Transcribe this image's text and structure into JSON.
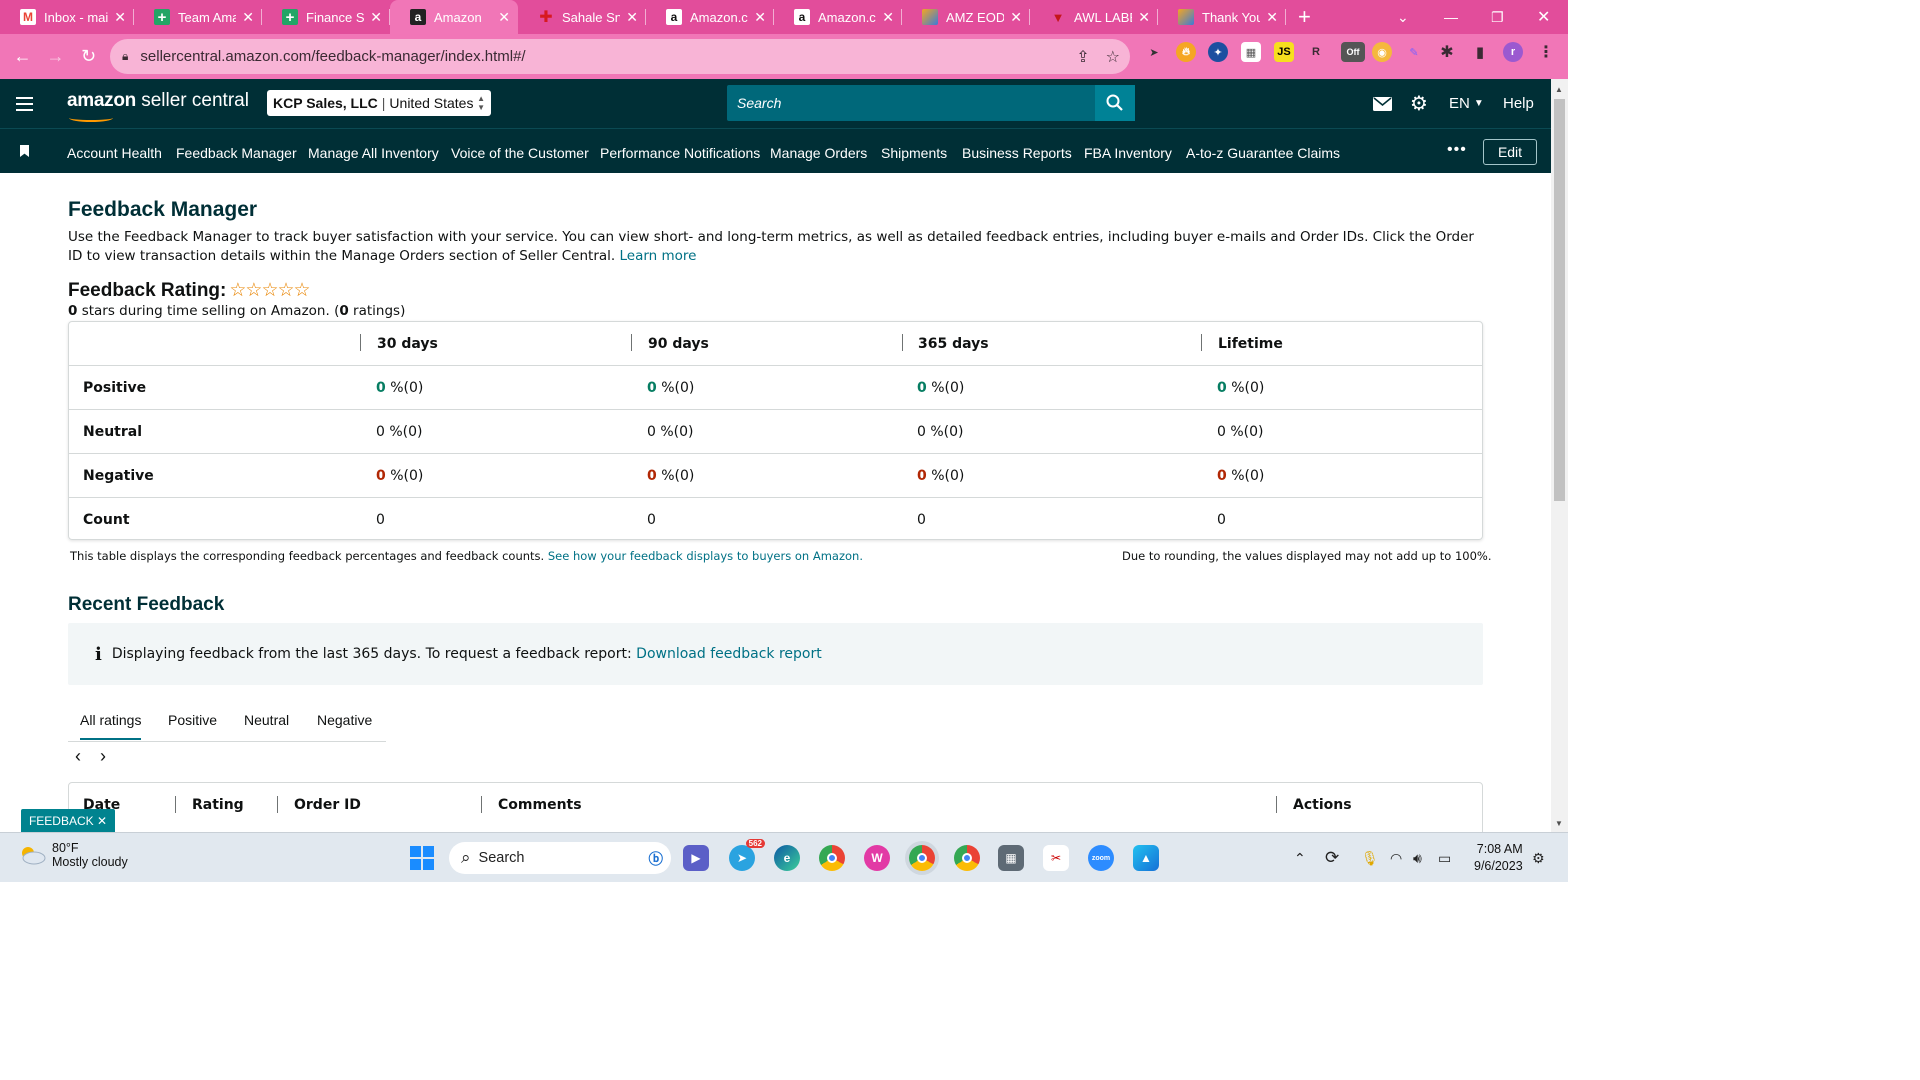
{
  "browser": {
    "tabs": [
      {
        "label": "Inbox - mai",
        "favicon": "gmail-icon",
        "active": false
      },
      {
        "label": "Team Amaz",
        "favicon": "sheets-plus-icon",
        "active": false
      },
      {
        "label": "Finance She",
        "favicon": "sheets-plus-icon",
        "active": false
      },
      {
        "label": "Amazon",
        "favicon": "amazon-a-icon",
        "active": true
      },
      {
        "label": "Sahale Snac",
        "favicon": "red-brand-icon",
        "active": false
      },
      {
        "label": "Amazon.co",
        "favicon": "amazon-a-icon",
        "active": false
      },
      {
        "label": "Amazon.co",
        "favicon": "amazon-a-icon",
        "active": false
      },
      {
        "label": "AMZ EOD R",
        "favicon": "pencil-app-icon",
        "active": false
      },
      {
        "label": "AWL LABEL",
        "favicon": "awl-icon",
        "active": false
      },
      {
        "label": "Thank You",
        "favicon": "pencil-app-icon",
        "active": false
      }
    ],
    "url": "sellercentral.amazon.com/feedback-manager/index.html#/",
    "extension_off_label": "Off",
    "profile_initial": "r",
    "js_badge": "JS",
    "rb_badge": "R"
  },
  "header": {
    "logo_amazon": "amazon",
    "logo_suffix": " seller central",
    "account_name": "KCP Sales, LLC",
    "account_region": "United States",
    "search_placeholder": "Search",
    "language": "EN",
    "help": "Help"
  },
  "nav": {
    "items": [
      "Account Health",
      "Feedback Manager",
      "Manage All Inventory",
      "Voice of the Customer",
      "Performance Notifications",
      "Manage Orders",
      "Shipments",
      "Business Reports",
      "FBA Inventory",
      "A-to-z Guarantee Claims"
    ],
    "more": "•••",
    "edit": "Edit"
  },
  "page": {
    "title": "Feedback Manager",
    "intro": "Use the Feedback Manager to track buyer satisfaction with your service. You can view short- and long-term metrics, as well as detailed feedback entries, including buyer e-mails and Order IDs. Click the Order ID to view transaction details within the Manage Orders section of Seller Central.",
    "learn_more": "Learn more",
    "rating_title": "Feedback Rating:",
    "stars": "☆☆☆☆☆",
    "rating_stars_value": "0",
    "rating_mid": " stars during time selling on Amazon. (",
    "rating_count": "0",
    "rating_end": " ratings)"
  },
  "table": {
    "columns": [
      "30 days",
      "90 days",
      "365 days",
      "Lifetime"
    ],
    "rows": [
      {
        "label": "Positive",
        "kind": "pos",
        "values": [
          "0",
          "0",
          "0",
          "0"
        ],
        "counts": [
          " %(0)",
          " %(0)",
          " %(0)",
          " %(0)"
        ]
      },
      {
        "label": "Neutral",
        "kind": "neu",
        "values": [
          "0",
          "0",
          "0",
          "0"
        ],
        "counts": [
          " %(0)",
          " %(0)",
          " %(0)",
          " %(0)"
        ]
      },
      {
        "label": "Negative",
        "kind": "neg",
        "values": [
          "0",
          "0",
          "0",
          "0"
        ],
        "counts": [
          " %(0)",
          " %(0)",
          " %(0)",
          " %(0)"
        ]
      },
      {
        "label": "Count",
        "kind": "plain",
        "values": [
          "0",
          "0",
          "0",
          "0"
        ],
        "counts": [
          "",
          "",
          "",
          ""
        ]
      }
    ],
    "note_left": "This table displays the corresponding feedback percentages and feedback counts.",
    "note_link": "See how your feedback displays to buyers on Amazon.",
    "note_right": "Due to rounding, the values displayed may not add up to 100%."
  },
  "recent": {
    "title": "Recent Feedback",
    "info_icon": "i",
    "info_text": "Displaying feedback from the last 365 days. To request a feedback report:",
    "info_link": "Download feedback report",
    "tabs": [
      "All ratings",
      "Positive",
      "Neutral",
      "Negative"
    ],
    "prev": "‹",
    "next": "›",
    "columns": [
      "Date",
      "Rating",
      "Order ID",
      "Comments",
      "Actions"
    ]
  },
  "feedback_badge": "FEEDBACK ✕",
  "taskbar": {
    "temp": "80°F",
    "weather": "Mostly cloudy",
    "search": "Search",
    "time": "7:08 AM",
    "date": "9/6/2023",
    "telegram_badge": "562"
  }
}
